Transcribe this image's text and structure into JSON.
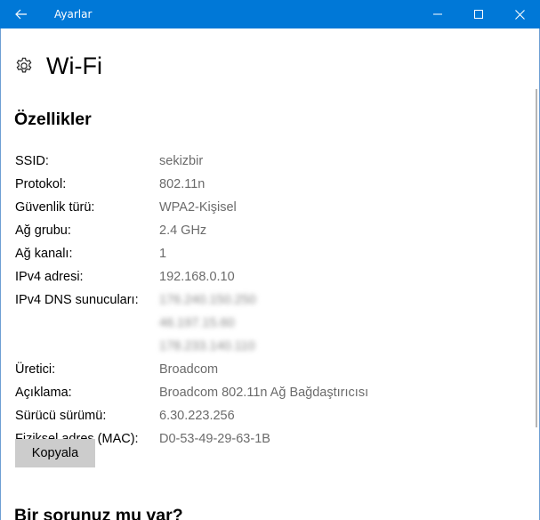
{
  "window": {
    "title": "Ayarlar"
  },
  "page": {
    "title": "Wi-Fi",
    "icon": "gear-icon"
  },
  "properties": {
    "section_title": "Özellikler",
    "ssid_label": "SSID:",
    "ssid_value": "sekizbir",
    "protocol_label": "Protokol:",
    "protocol_value": "802.11n",
    "security_label": "Güvenlik türü:",
    "security_value": "WPA2-Kişisel",
    "band_label": "Ağ grubu:",
    "band_value": "2.4 GHz",
    "channel_label": "Ağ kanalı:",
    "channel_value": "1",
    "ipv4_label": "IPv4 adresi:",
    "ipv4_value": "192.168.0.10",
    "dns_label": "IPv4 DNS sunucuları:",
    "dns_values": [
      "176.240.150.250",
      "46.197.15.60",
      "178.233.140.110"
    ],
    "manufacturer_label": "Üretici:",
    "manufacturer_value": "Broadcom",
    "description_label": "Açıklama:",
    "description_value": "Broadcom 802.11n Ağ Bağdaştırıcısı",
    "driver_label": "Sürücü sürümü:",
    "driver_value": "6.30.223.256",
    "mac_label": "Fiziksel adres (MAC):",
    "mac_value": "D0-53-49-29-63-1B",
    "copy_button": "Kopyala"
  },
  "help": {
    "title": "Bir sorunuz mu var?"
  },
  "colors": {
    "titlebar": "#0078d7",
    "value_text": "#6b6b6b",
    "button_bg": "#cccccc"
  }
}
